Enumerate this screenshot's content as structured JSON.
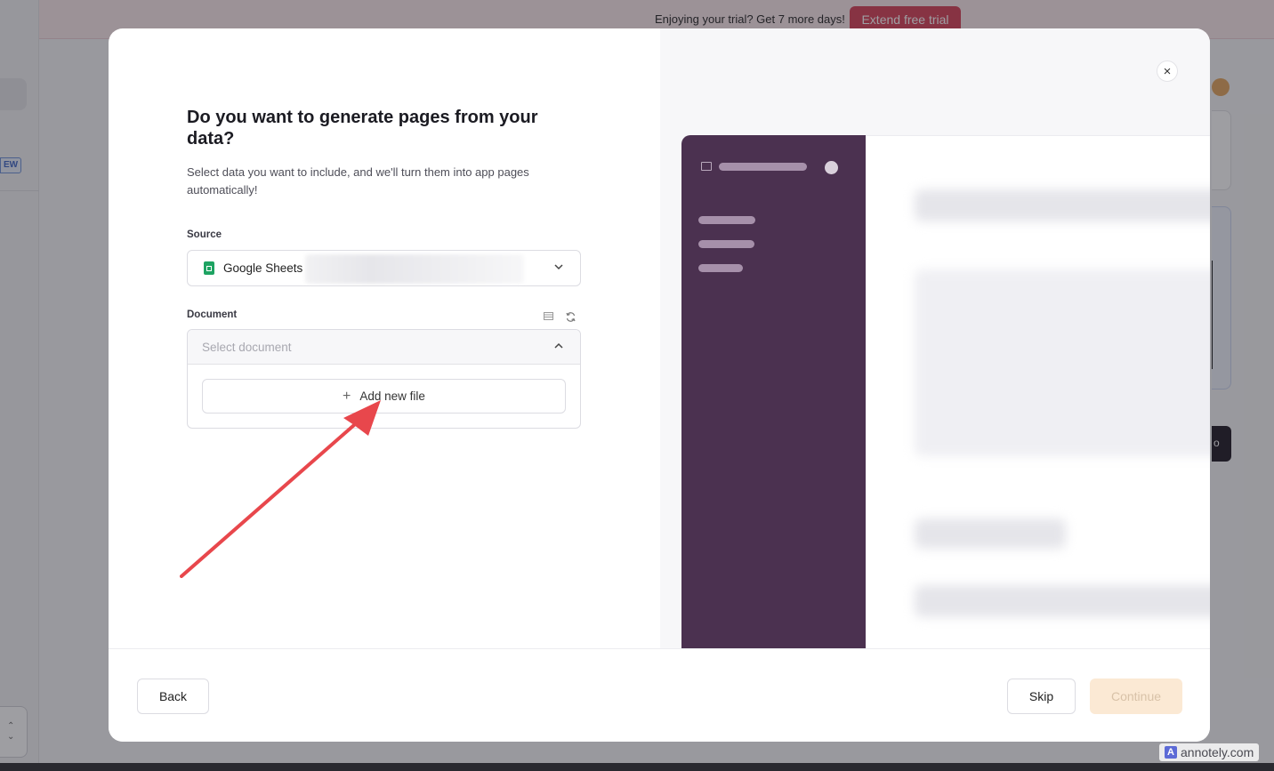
{
  "banner": {
    "text": "Enjoying your trial? Get 7 more days!",
    "button_label": "Extend free trial"
  },
  "background": {
    "new_badge": "EW",
    "stepper_up": "⌃",
    "stepper_down": "⌄",
    "partial_button_text": "o"
  },
  "modal": {
    "title": "Do you want to generate pages from your data?",
    "subtitle": "Select data you want to include, and we'll turn them into app pages automatically!",
    "close_icon": "×",
    "source": {
      "label": "Source",
      "value": "Google Sheets",
      "icon": "google-sheets-icon"
    },
    "document": {
      "label": "Document",
      "placeholder": "Select document",
      "add_file_label": "Add new file",
      "tool_icons": [
        "table-icon",
        "refresh-icon"
      ]
    },
    "footer": {
      "back_label": "Back",
      "skip_label": "Skip",
      "continue_label": "Continue"
    }
  },
  "colors": {
    "accent": "#d63c52",
    "preview_sidebar": "#4b3150",
    "continue_disabled": "#fbe9d4",
    "annotation_arrow": "#e8474c"
  },
  "watermark": {
    "text": "annotely.com",
    "logo": "A"
  }
}
